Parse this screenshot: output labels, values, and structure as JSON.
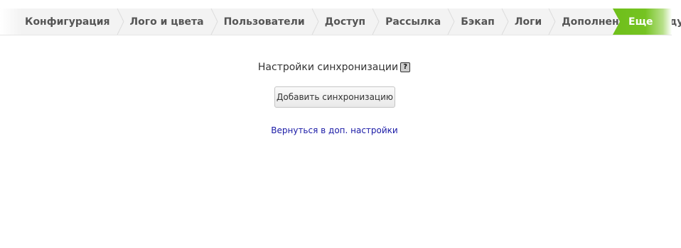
{
  "nav": {
    "tabs": [
      {
        "label": "Конфигурация"
      },
      {
        "label": "Лого и цвета"
      },
      {
        "label": "Пользователи"
      },
      {
        "label": "Доступ"
      },
      {
        "label": "Рассылка"
      },
      {
        "label": "Бэкап"
      },
      {
        "label": "Логи"
      },
      {
        "label": "Дополнения"
      },
      {
        "label": "Модули"
      }
    ],
    "active_tab": {
      "label": "Еще"
    },
    "active_color": "#75c322"
  },
  "main": {
    "title": "Настройки синхронизации",
    "help_icon": {
      "glyph": "?",
      "name": "help-icon"
    },
    "add_button_label": "Добавить синхронизацию",
    "back_link_label": "Вернуться в доп. настройки",
    "link_color": "#1a1aa6"
  }
}
